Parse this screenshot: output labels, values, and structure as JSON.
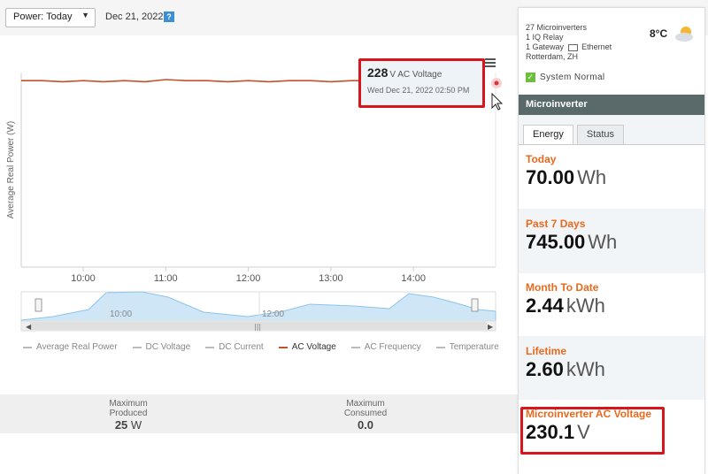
{
  "toolbar": {
    "period_select": "Power: Today",
    "date": "Dec 21, 2022",
    "help": "?"
  },
  "chart": {
    "ylabel": "Average Real Power (W)",
    "x_ticks": [
      "10:00",
      "11:00",
      "12:00",
      "13:00",
      "14:00"
    ],
    "navigator_ticks": [
      "10:00",
      "12:00"
    ],
    "legend": [
      "Average Real Power",
      "DC Voltage",
      "DC Current",
      "AC Voltage",
      "AC Frequency",
      "Temperature"
    ],
    "active_series": "AC Voltage",
    "colors": {
      "ac_voltage": "#c0522c",
      "navigator_fill": "#cfe6f7",
      "navigator_line": "#8cc4ec"
    }
  },
  "chart_data": {
    "type": "line",
    "series": [
      {
        "name": "AC Voltage",
        "x": [
          "09:15",
          "09:30",
          "09:45",
          "10:00",
          "10:15",
          "10:30",
          "10:45",
          "11:00",
          "11:15",
          "11:30",
          "11:45",
          "12:00",
          "12:15",
          "12:30",
          "12:45",
          "13:00",
          "13:15",
          "13:30",
          "13:45",
          "14:00",
          "14:15",
          "14:30",
          "14:50"
        ],
        "values": [
          229,
          229,
          228,
          229,
          228,
          229,
          228,
          230,
          229,
          229,
          228,
          229,
          228,
          229,
          229,
          228,
          229,
          229,
          228,
          228,
          229,
          228,
          228
        ]
      }
    ],
    "xlabel": "",
    "ylabel": "Average Real Power (W)"
  },
  "tooltip": {
    "value": "228",
    "unit": "V AC Voltage",
    "time": "Wed Dec 21, 2022 02:50 PM"
  },
  "stats": {
    "max_produced_label": "Maximum\nProduced",
    "max_produced_value": "25",
    "max_produced_unit": "W",
    "max_consumed_label": "Maximum\nConsumed",
    "max_consumed_value": "0.0"
  },
  "site": {
    "microinverters": "27 Microinverters",
    "relay": "1 IQ Relay",
    "gateway": "1 Gateway",
    "ethernet": "Ethernet",
    "location": "Rotterdam, ZH",
    "temperature": "8°C",
    "system_status": "System Normal"
  },
  "panel": {
    "header": "Microinverter",
    "tabs": [
      "Energy",
      "Status"
    ],
    "today_label": "Today",
    "today_value": "70.00",
    "today_unit": "Wh",
    "week_label": "Past 7 Days",
    "week_value": "745.00",
    "week_unit": "Wh",
    "month_label": "Month To Date",
    "month_value": "2.44",
    "month_unit": "kWh",
    "lifetime_label": "Lifetime",
    "lifetime_value": "2.60",
    "lifetime_unit": "kWh",
    "acv_label": "Microinverter AC Voltage",
    "acv_value": "230.1",
    "acv_unit": "V"
  }
}
